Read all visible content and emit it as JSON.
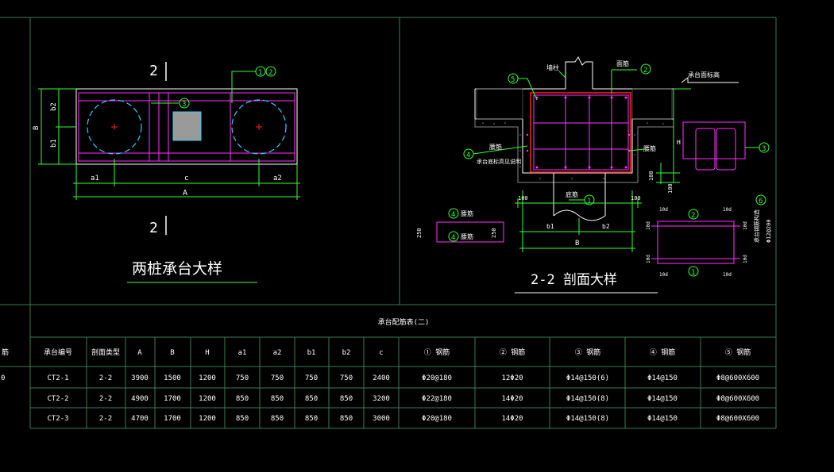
{
  "colors": {
    "background": "#000000",
    "frame": "#3a7a5a",
    "white": "#ffffff",
    "green": "#33ff33",
    "magenta": "#ff33ff",
    "cyan": "#33ccff",
    "red": "#ff2020",
    "gray_fill": "#9a9a9a"
  },
  "left_drawing": {
    "section_top": "2",
    "section_bottom": "2",
    "title": "两桩承台大样",
    "dim_a1": "a1",
    "dim_c": "c",
    "dim_a2": "a2",
    "dim_A": "A",
    "dim_B": "B",
    "dim_b1": "b1",
    "dim_b2": "b2",
    "callout_3": "3",
    "callout_1": "1",
    "callout_2": "2"
  },
  "right_drawing": {
    "title": "2-2 剖面大样",
    "label_column": "墙柱",
    "label_bar2": "面筋",
    "label_cap_top": "承台面标高",
    "label_side_bar": "腰筋",
    "label_side_note": "承台底标高见说明",
    "label_waist_bar": "腰筋",
    "label_bottom_bar": "底筋",
    "dim_H": "H",
    "dim_100a": "100",
    "dim_100b": "100",
    "dim_100c": "100",
    "dim_100d": "100",
    "dim_b1": "b1",
    "dim_b2": "b2",
    "dim_B": "B",
    "callout_5": "5",
    "callout_2": "2",
    "callout_4": "4",
    "callout_3": "3",
    "callout_1": "1",
    "callout_6": "6",
    "small_box_label_top": "腰筋",
    "small_box_label_bottom": "腰筋",
    "small_box_dim": "250",
    "rebar_note": "承台钢筋构造",
    "rebar_spec": "Φ12@200",
    "corner_labels": [
      "10d",
      "10d",
      "10d",
      "10d",
      "10d",
      "10d",
      "10d",
      "10d"
    ]
  },
  "table": {
    "title": "承台配筋表(二)",
    "left_cut_header": "筋",
    "left_cut_row1": "0",
    "headers": [
      "承台编号",
      "剖面类型",
      "A",
      "B",
      "H",
      "a1",
      "a2",
      "b1",
      "b2",
      "c",
      "① 钢筋",
      "② 钢筋",
      "③ 钢筋",
      "④ 钢筋",
      "⑤ 钢筋"
    ],
    "rows": [
      [
        "CT2-1",
        "2-2",
        "3900",
        "1500",
        "1200",
        "750",
        "750",
        "750",
        "750",
        "2400",
        "Φ20@180",
        "12Φ20",
        "Φ14@150(6)",
        "Φ14@150",
        "Φ8@600X600"
      ],
      [
        "CT2-2",
        "2-2",
        "4900",
        "1700",
        "1200",
        "850",
        "850",
        "850",
        "850",
        "3200",
        "Φ22@180",
        "14Φ20",
        "Φ14@150(8)",
        "Φ14@150",
        "Φ8@600X600"
      ],
      [
        "CT2-3",
        "2-2",
        "4700",
        "1700",
        "1200",
        "850",
        "850",
        "850",
        "850",
        "3000",
        "Φ20@180",
        "14Φ20",
        "Φ14@150(8)",
        "Φ14@150",
        "Φ8@600X600"
      ]
    ]
  }
}
